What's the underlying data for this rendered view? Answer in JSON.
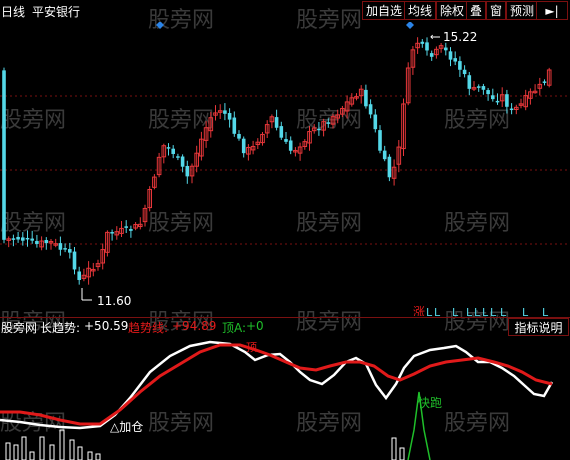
{
  "header": {
    "period": "日线",
    "stock_name": "平安银行",
    "buttons": [
      "加自选",
      "均线",
      "除权",
      "叠",
      "窗",
      "预测"
    ],
    "arrow_glyph": "►|"
  },
  "watermark": "股旁网",
  "price_chart": {
    "high_label": "15.22",
    "low_label": "11.60",
    "signal_labels": [
      "涨",
      "L",
      "L",
      "L",
      "L",
      "L",
      "L",
      "L",
      "L",
      "L",
      "L"
    ]
  },
  "indicator": {
    "site": "股旁网",
    "name": "长趋势:",
    "long_value": "+50.59",
    "trend_label": "趋势线:",
    "trend_value": "+94.89",
    "top_label": "顶A:",
    "top_value": "+0",
    "desc_button": "指标说明",
    "marker_top": "顶",
    "marker_run": "快跑",
    "marker_add": "△加仓"
  },
  "colors": {
    "up": "#e8373a",
    "down": "#54d8e8",
    "white": "#ffffff",
    "red": "#e01a1a",
    "green": "#1fbf2a",
    "diamond": "#2b84e8",
    "grid": "#7a1010"
  }
}
